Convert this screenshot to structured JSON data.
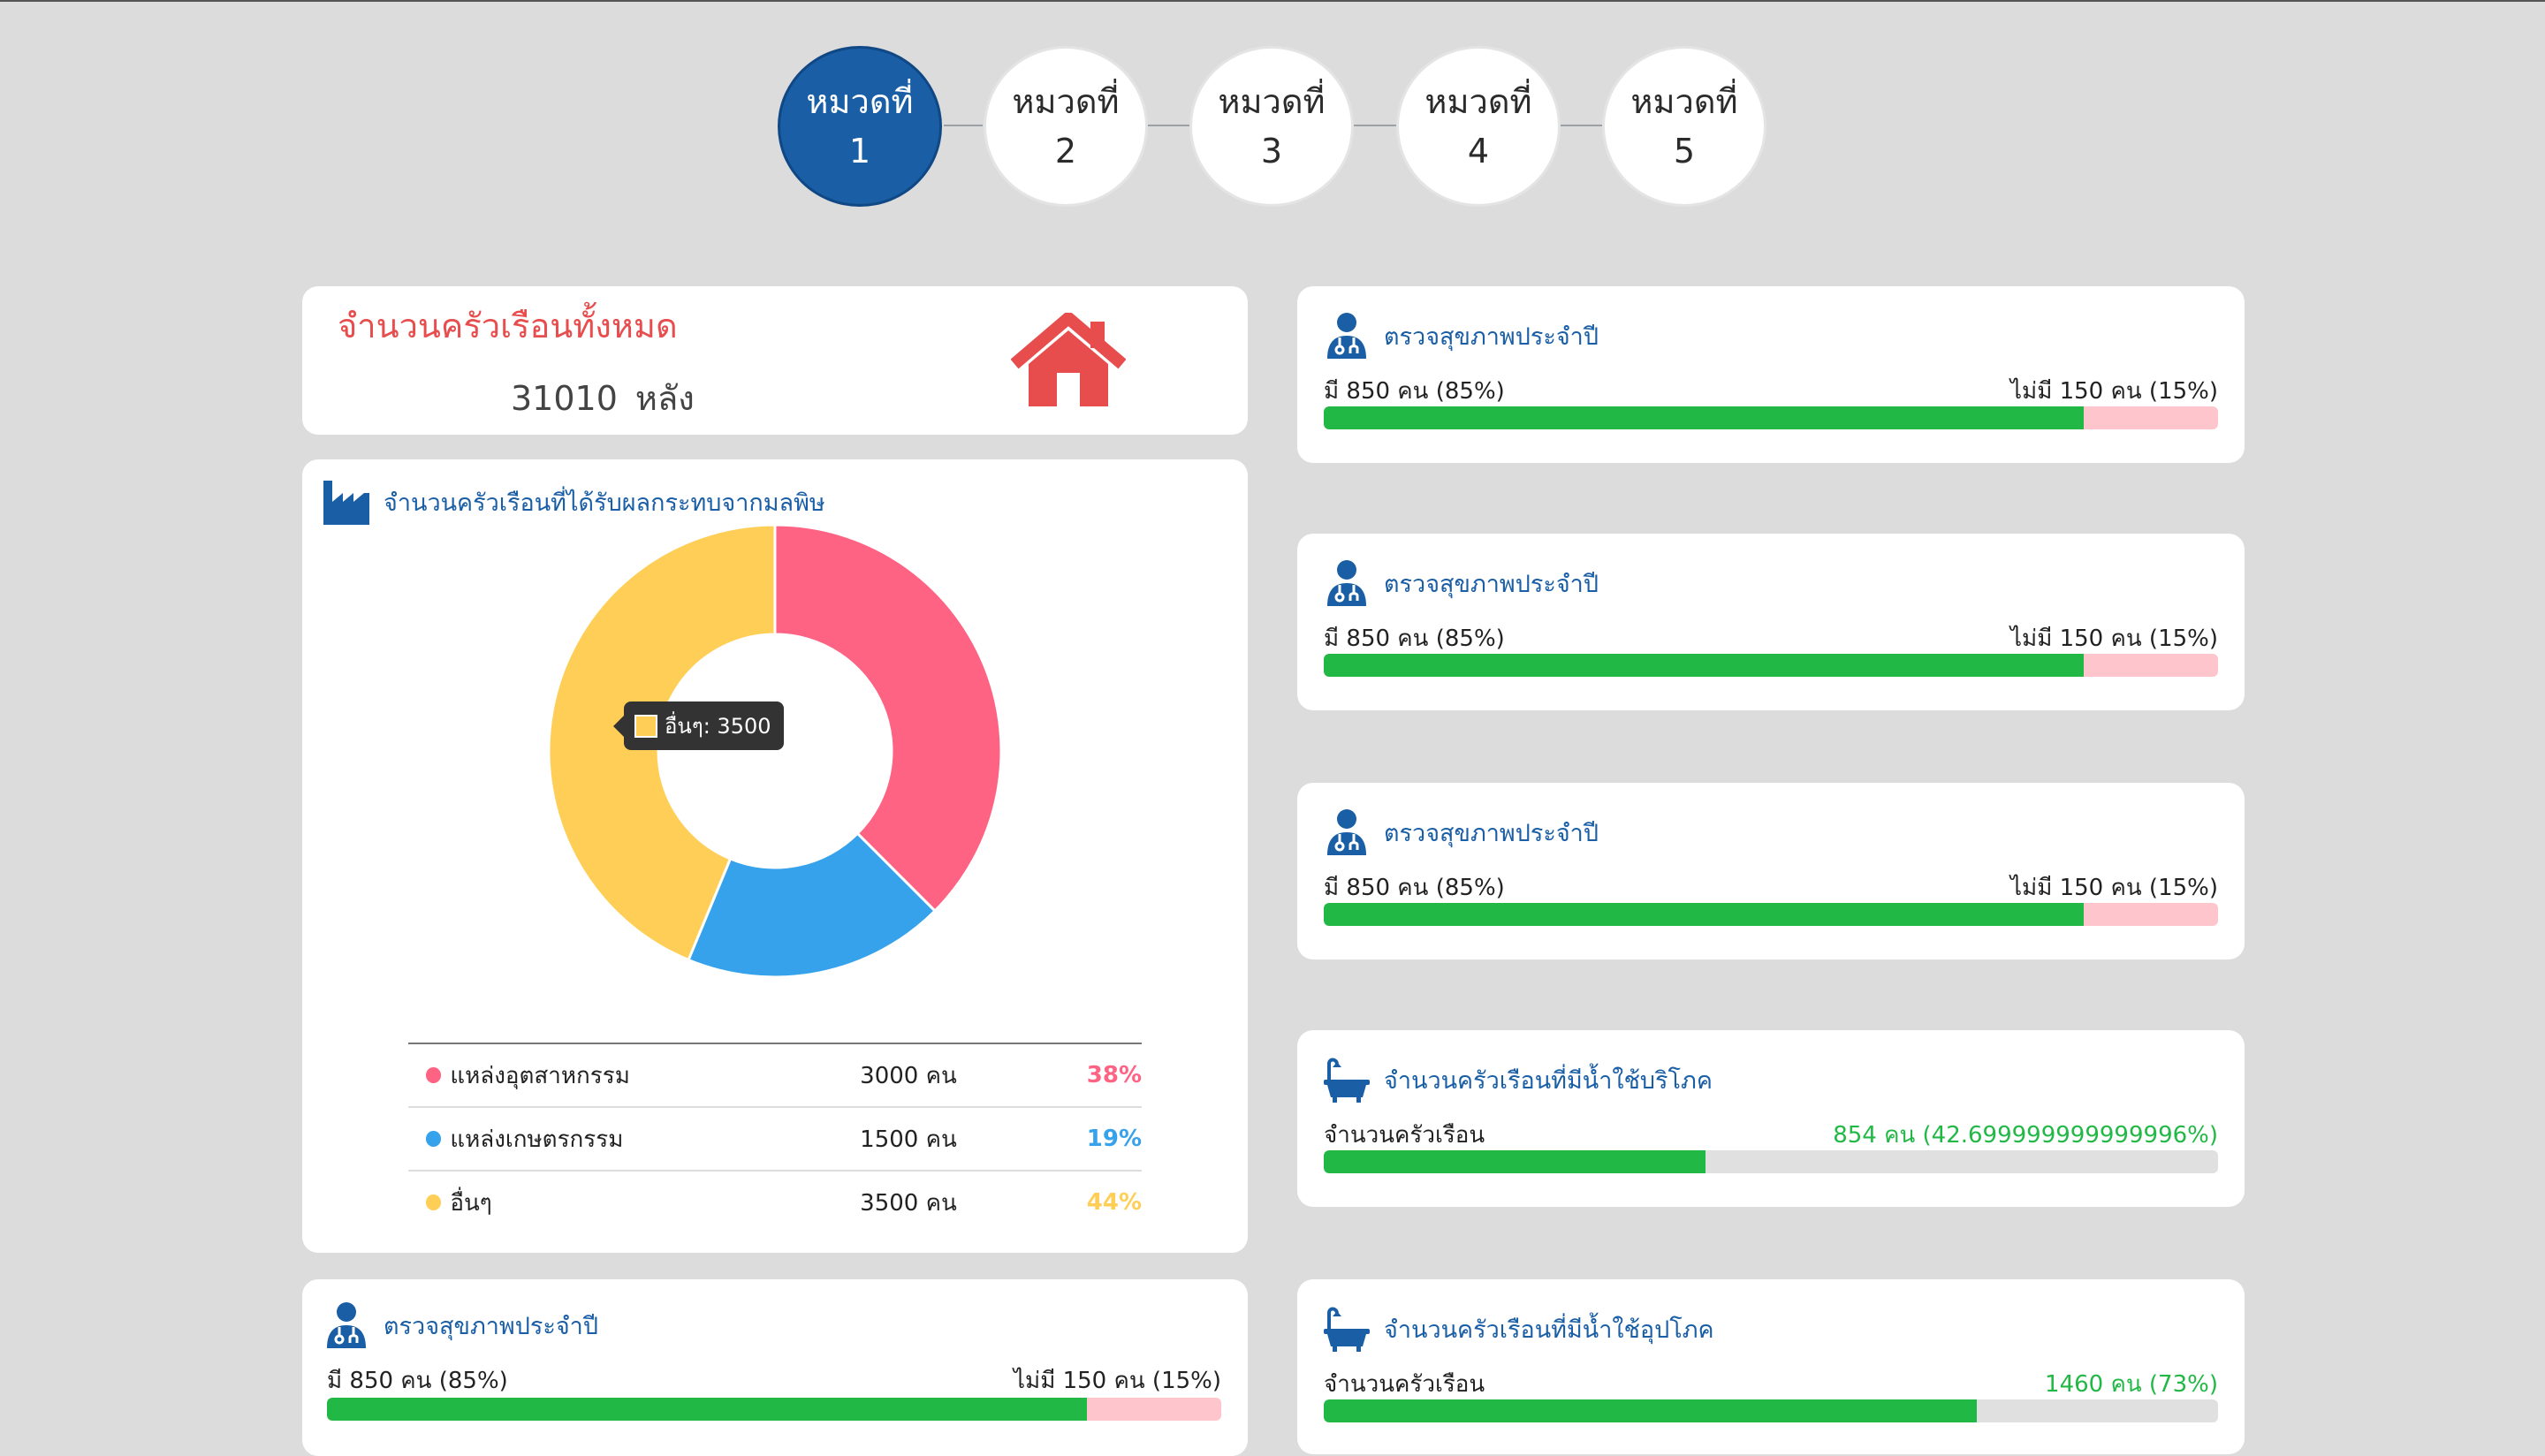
{
  "stepper": {
    "steps": [
      {
        "label": "หมวดที่",
        "num": "1"
      },
      {
        "label": "หมวดที่",
        "num": "2"
      },
      {
        "label": "หมวดที่",
        "num": "3"
      },
      {
        "label": "หมวดที่",
        "num": "4"
      },
      {
        "label": "หมวดที่",
        "num": "5"
      }
    ],
    "active_index": 0
  },
  "total_card": {
    "title": "จำนวนครัวเรือนทั้งหมด",
    "value": "31010",
    "unit": "หลัง",
    "icon": "house-icon"
  },
  "pollution_card": {
    "title": "จำนวนครัวเรือนที่ได้รับผลกระทบจากมลพิษ",
    "icon": "factory-icon",
    "tooltip": "อื่นๆ: 3500",
    "legend": [
      {
        "label": "แหล่งอุตสาหกรรม",
        "count": "3000 คน",
        "pct": "38%",
        "color": "#ff6384"
      },
      {
        "label": "แหล่งเกษตรกรรม",
        "count": "1500 คน",
        "pct": "19%",
        "color": "#36a2eb"
      },
      {
        "label": "อื่นๆ",
        "count": "3500 คน",
        "pct": "44%",
        "color": "#ffce56"
      }
    ]
  },
  "chart_data": {
    "type": "pie",
    "categories": [
      "แหล่งอุตสาหกรรม",
      "แหล่งเกษตรกรรม",
      "อื่นๆ"
    ],
    "values": [
      3000,
      1500,
      3500
    ],
    "colors": [
      "#ff6384",
      "#36a2eb",
      "#ffce56"
    ]
  },
  "health_card": {
    "title": "ตรวจสุขภาพประจำปี",
    "icon": "doctor-icon",
    "have_text": "มี 850 คน (85%)",
    "not_have_text": "ไม่มี 150 คน (15%)",
    "fraction": 0.85
  },
  "right_cards": [
    {
      "title": "ตรวจสุขภาพประจำปี",
      "icon": "doctor-icon",
      "left_text": "มี 850 คน (85%)",
      "right_text": "ไม่มี 150 คน (15%)",
      "fraction": 0.85,
      "kind": "pink"
    },
    {
      "title": "ตรวจสุขภาพประจำปี",
      "icon": "doctor-icon",
      "left_text": "มี 850 คน (85%)",
      "right_text": "ไม่มี 150 คน (15%)",
      "fraction": 0.85,
      "kind": "pink"
    },
    {
      "title": "ตรวจสุขภาพประจำปี",
      "icon": "doctor-icon",
      "left_text": "มี 850 คน (85%)",
      "right_text": "ไม่มี 150 คน (15%)",
      "fraction": 0.85,
      "kind": "pink"
    },
    {
      "title": "จำนวนครัวเรือนที่มีน้ำใช้บริโภค",
      "icon": "bathtub-icon",
      "left_text": "จำนวนครัวเรือน",
      "right_text": "854 คน (42.699999999999996%)",
      "fraction": 0.427,
      "kind": "grey"
    },
    {
      "title": "จำนวนครัวเรือนที่มีน้ำใช้อุปโภค",
      "icon": "bathtub-icon",
      "left_text": "จำนวนครัวเรือน",
      "right_text": "1460 คน (73%)",
      "fraction": 0.73,
      "kind": "grey"
    }
  ],
  "colors": {
    "accent": "#1a5ea6",
    "danger": "#e84d4d",
    "success": "#22b846",
    "background": "#dcdcdc"
  }
}
